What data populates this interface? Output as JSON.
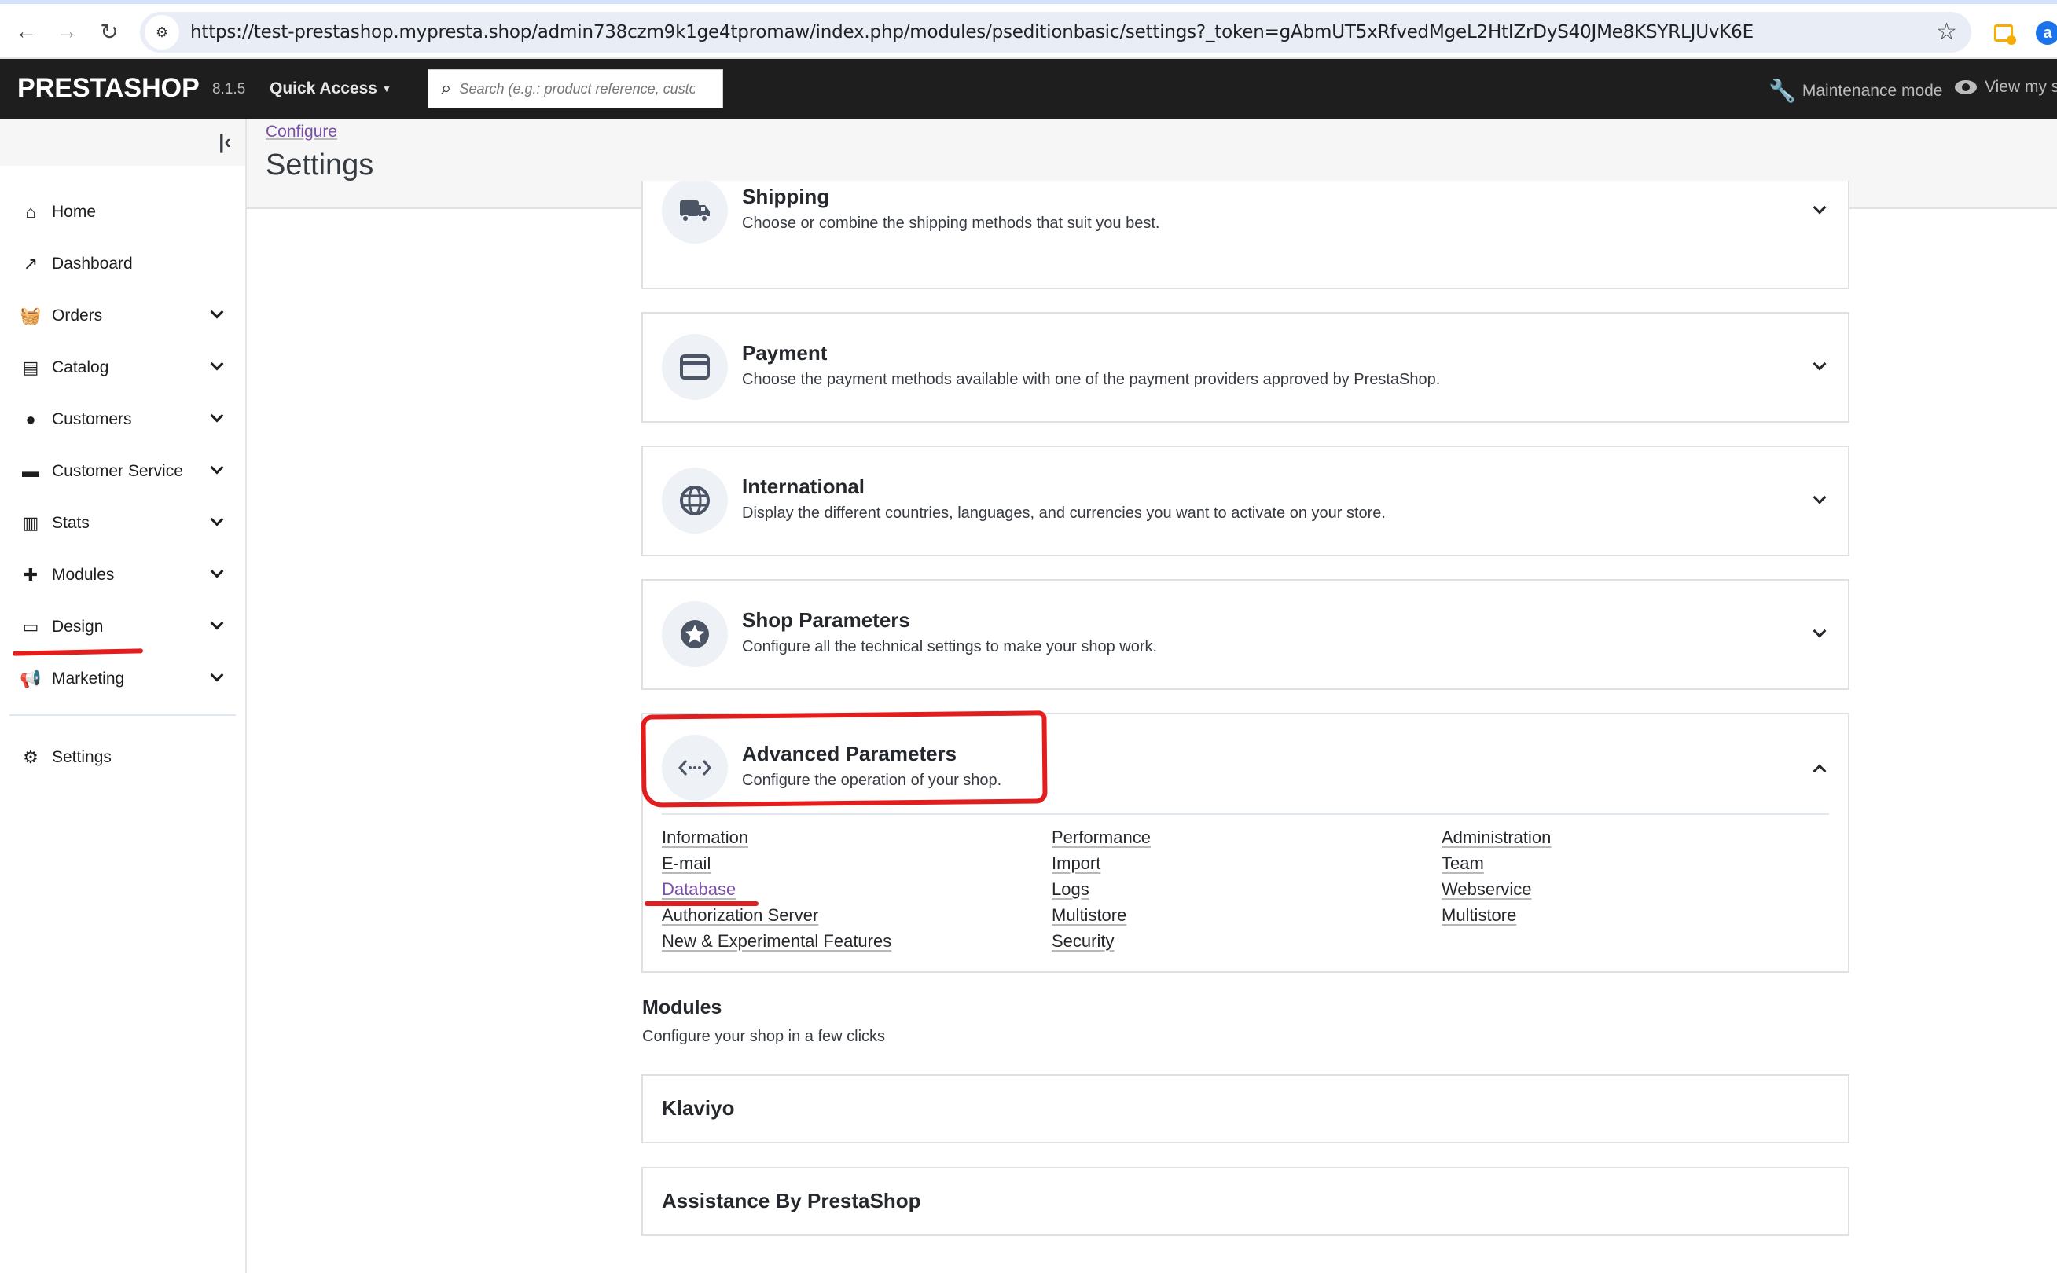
{
  "browser": {
    "url": "https://test-prestashop.mypresta.shop/admin738czm9k1ge4tpromaw/index.php/modules/pseditionbasic/settings?_token=gAbmUT5xRfvedMgeL2HtIZrDyS40JMe8KSYRLJUvK6E",
    "back_icon": "←",
    "forward_icon": "→",
    "reload_icon": "↻",
    "site_info_icon": "⚙",
    "star_icon": "☆",
    "extension_2_glyph": "a"
  },
  "header": {
    "logo": "PRESTASHOP",
    "version": "8.1.5",
    "quick_access": "Quick Access",
    "search_placeholder": "Search (e.g.: product reference, custon",
    "maintenance_mode": "Maintenance mode",
    "view_store": "View my st"
  },
  "sidebar": {
    "collapse_icon": "|‹",
    "items": [
      {
        "label": "Home",
        "icon": "⌂",
        "has_submenu": false
      },
      {
        "label": "Dashboard",
        "icon": "↗",
        "has_submenu": false
      },
      {
        "label": "Orders",
        "icon": "🧺",
        "has_submenu": true
      },
      {
        "label": "Catalog",
        "icon": "▤",
        "has_submenu": true
      },
      {
        "label": "Customers",
        "icon": "●",
        "has_submenu": true
      },
      {
        "label": "Customer Service",
        "icon": "▬",
        "has_submenu": true
      },
      {
        "label": "Stats",
        "icon": "▥",
        "has_submenu": true
      },
      {
        "label": "Modules",
        "icon": "✚",
        "has_submenu": true
      },
      {
        "label": "Design",
        "icon": "▭",
        "has_submenu": true
      },
      {
        "label": "Marketing",
        "icon": "📢",
        "has_submenu": true
      }
    ],
    "settings": {
      "label": "Settings",
      "icon": "⚙"
    }
  },
  "page": {
    "breadcrumb": "Configure",
    "title": "Settings"
  },
  "sections": [
    {
      "title": "Shipping",
      "description": "Choose or combine the shipping methods that suit you best.",
      "icon": "truck-icon",
      "expanded": false
    },
    {
      "title": "Payment",
      "description": "Choose the payment methods available with one of the payment providers approved by PrestaShop.",
      "icon": "credit-card-icon",
      "expanded": false
    },
    {
      "title": "International",
      "description": "Display the different countries, languages, and currencies you want to activate on your store.",
      "icon": "globe-icon",
      "expanded": false
    },
    {
      "title": "Shop Parameters",
      "description": "Configure all the technical settings to make your shop work.",
      "icon": "star-icon",
      "expanded": false
    },
    {
      "title": "Advanced Parameters",
      "description": "Configure the operation of your shop.",
      "icon": "code-icon",
      "expanded": true,
      "links": [
        [
          "Information",
          "E-mail",
          "Database",
          "Authorization Server",
          "New & Experimental Features"
        ],
        [
          "Performance",
          "Import",
          "Logs",
          "Multistore",
          "Security"
        ],
        [
          "Administration",
          "Team",
          "Webservice",
          "Multistore"
        ]
      ]
    }
  ],
  "modules": {
    "title": "Modules",
    "subtitle": "Configure your shop in a few clicks",
    "items": [
      "Klaviyo",
      "Assistance By PrestaShop"
    ]
  },
  "annotations": {
    "color": "#e21d1d"
  }
}
